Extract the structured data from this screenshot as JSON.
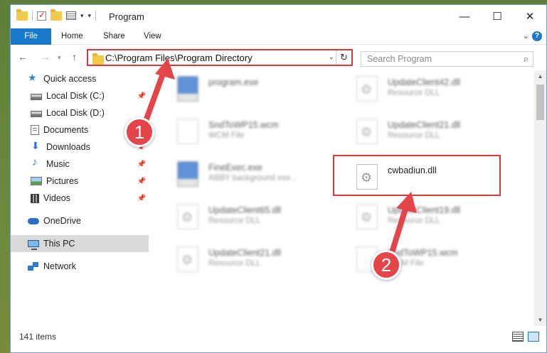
{
  "window": {
    "title": "Program"
  },
  "ribbon": {
    "tabs": [
      "File",
      "Home",
      "Share",
      "View"
    ]
  },
  "address": {
    "path": "C:\\Program Files\\Program Directory"
  },
  "search": {
    "placeholder": "Search Program"
  },
  "nav": {
    "items": [
      {
        "label": "Quick access",
        "icon": "quick-access-star-icon",
        "pinned": false
      },
      {
        "label": "Local Disk (C:)",
        "icon": "disk-icon",
        "pinned": true
      },
      {
        "label": "Local Disk (D:)",
        "icon": "disk-icon",
        "pinned": false
      },
      {
        "label": "Documents",
        "icon": "documents-icon",
        "pinned": false
      },
      {
        "label": "Downloads",
        "icon": "downloads-icon",
        "pinned": true
      },
      {
        "label": "Music",
        "icon": "music-icon",
        "pinned": true
      },
      {
        "label": "Pictures",
        "icon": "pictures-icon",
        "pinned": true
      },
      {
        "label": "Videos",
        "icon": "videos-icon",
        "pinned": true
      },
      {
        "label": "OneDrive",
        "icon": "onedrive-icon",
        "pinned": false
      },
      {
        "label": "This PC",
        "icon": "this-pc-icon",
        "pinned": false,
        "selected": true
      },
      {
        "label": "Network",
        "icon": "network-icon",
        "pinned": false
      }
    ]
  },
  "files": [
    {
      "name": "program.exe",
      "type": "",
      "icon": "exe-icon"
    },
    {
      "name": "UpdateClient42.dll",
      "type": "Resource DLL",
      "icon": "dll-gear-icon"
    },
    {
      "name": "SndToWP15.wcm",
      "type": "WCM File",
      "icon": "blank-file-icon"
    },
    {
      "name": "UpdateClient21.dll",
      "type": "Resource DLL",
      "icon": "dll-gear-icon"
    },
    {
      "name": "FineExec.exe",
      "type": "ABBY background exe...",
      "icon": "exe-icon"
    },
    {
      "name": "cwbadiun.dll",
      "type": "",
      "icon": "dll-gear-icon",
      "highlighted": true
    },
    {
      "name": "UpdateClient65.dll",
      "type": "Resource DLL",
      "icon": "dll-gear-icon"
    },
    {
      "name": "UpdateClient19.dll",
      "type": "Resource DLL",
      "icon": "dll-gear-icon"
    },
    {
      "name": "UpdateClient21.dll",
      "type": "Resource DLL",
      "icon": "dll-gear-icon"
    },
    {
      "name": "SndToWP15.wcm",
      "type": "WCM File",
      "icon": "blank-file-icon"
    }
  ],
  "status": {
    "item_count": "141 items"
  },
  "annotations": {
    "step1": "1",
    "step2": "2",
    "color": "#e34548"
  },
  "colors": {
    "accent": "#1979ca",
    "highlight": "#d9383a"
  }
}
